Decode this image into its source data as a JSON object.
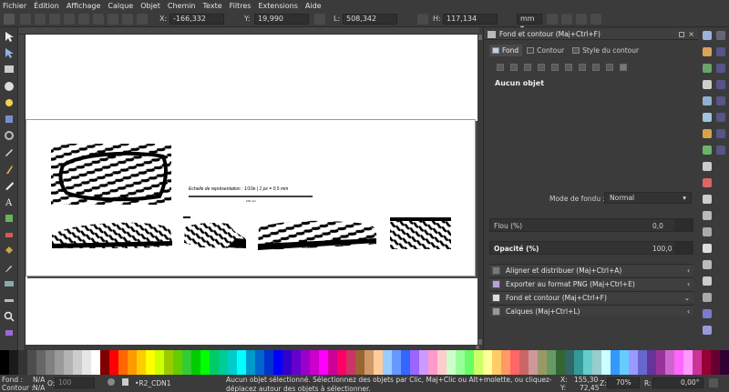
{
  "menu": [
    "Fichier",
    "Édition",
    "Affichage",
    "Calque",
    "Objet",
    "Chemin",
    "Texte",
    "Filtres",
    "Extensions",
    "Aide"
  ],
  "toolbar": {
    "x_label": "X:",
    "x_value": "-166,332",
    "y_label": "Y:",
    "y_value": "19,990",
    "w_label": "L:",
    "w_value": "508,342",
    "h_label": "H:",
    "h_value": "117,134",
    "unit": "mm"
  },
  "drawing": {
    "scale_text": "Echelle de représentation : 1/10e | 1 px = 0,5 mm",
    "scale_unit": "100 mm"
  },
  "dock": {
    "panel_title": "Fond et contour (Maj+Ctrl+F)",
    "tabs": [
      "Fond",
      "Contour",
      "Style du contour"
    ],
    "no_object": "Aucun objet",
    "blend_label": "Mode de fondu :",
    "blend_value": "Normal",
    "blur_label": "Flou (%)",
    "blur_value": "0,0",
    "opacity_label": "Opacité (%)",
    "opacity_value": "100,0",
    "sections": [
      "Aligner et distribuer (Maj+Ctrl+A)",
      "Exporter au format PNG (Maj+Ctrl+E)",
      "Fond et contour (Maj+Ctrl+F)",
      "Calques (Maj+Ctrl+L)"
    ]
  },
  "status": {
    "fill_label": "Fond :",
    "fill_value": "N/A",
    "stroke_label": "Contour :",
    "stroke_value": "N/A",
    "opacity_label": "O:",
    "opacity_value": "100",
    "layer": "•R2_CDN1",
    "message": "Aucun objet sélectionné. Sélectionnez des objets par Clic, Maj+Clic ou Alt+molette, ou cliquez-déplacez autour des objets à sélectionner.",
    "x_label": "X:",
    "x_value": "155,30",
    "y_label": "Y:",
    "y_value": "72,45",
    "zoom_label": "Z:",
    "zoom_value": "70%",
    "rot_label": "R:",
    "rot_value": "0,00°"
  },
  "palette": [
    "#000000",
    "#1a1a1a",
    "#333333",
    "#4d4d4d",
    "#666666",
    "#808080",
    "#999999",
    "#b3b3b3",
    "#cccccc",
    "#e6e6e6",
    "#ffffff",
    "#800000",
    "#ff0000",
    "#ff6600",
    "#ff9900",
    "#ffcc00",
    "#ffff00",
    "#ccff00",
    "#99cc00",
    "#66cc00",
    "#33cc33",
    "#00cc00",
    "#00ff00",
    "#00cc66",
    "#00cc99",
    "#00cccc",
    "#00ffff",
    "#0099cc",
    "#0066cc",
    "#0033cc",
    "#0000ff",
    "#3300cc",
    "#6600cc",
    "#9900cc",
    "#cc00cc",
    "#ff00ff",
    "#cc0099",
    "#ff0066",
    "#cc3366",
    "#996633",
    "#cc9966",
    "#ffcc99",
    "#99ccff",
    "#6699ff",
    "#3366ff",
    "#9966ff",
    "#cc99ff",
    "#ff99cc",
    "#ffcccc",
    "#ccffcc",
    "#99ff99",
    "#66ff66",
    "#ccff66",
    "#ffff99",
    "#ffcc66",
    "#ff9966",
    "#ff6666",
    "#cc6666",
    "#cc9999",
    "#999966",
    "#669966",
    "#336633",
    "#336666",
    "#339999",
    "#66cccc",
    "#99cccc",
    "#ccffff",
    "#3399ff",
    "#66ccff",
    "#9999ff",
    "#6666cc",
    "#663399",
    "#993399",
    "#cc66cc",
    "#ff66ff",
    "#ff99ff",
    "#cc3399",
    "#990033",
    "#660033",
    "#330033"
  ]
}
